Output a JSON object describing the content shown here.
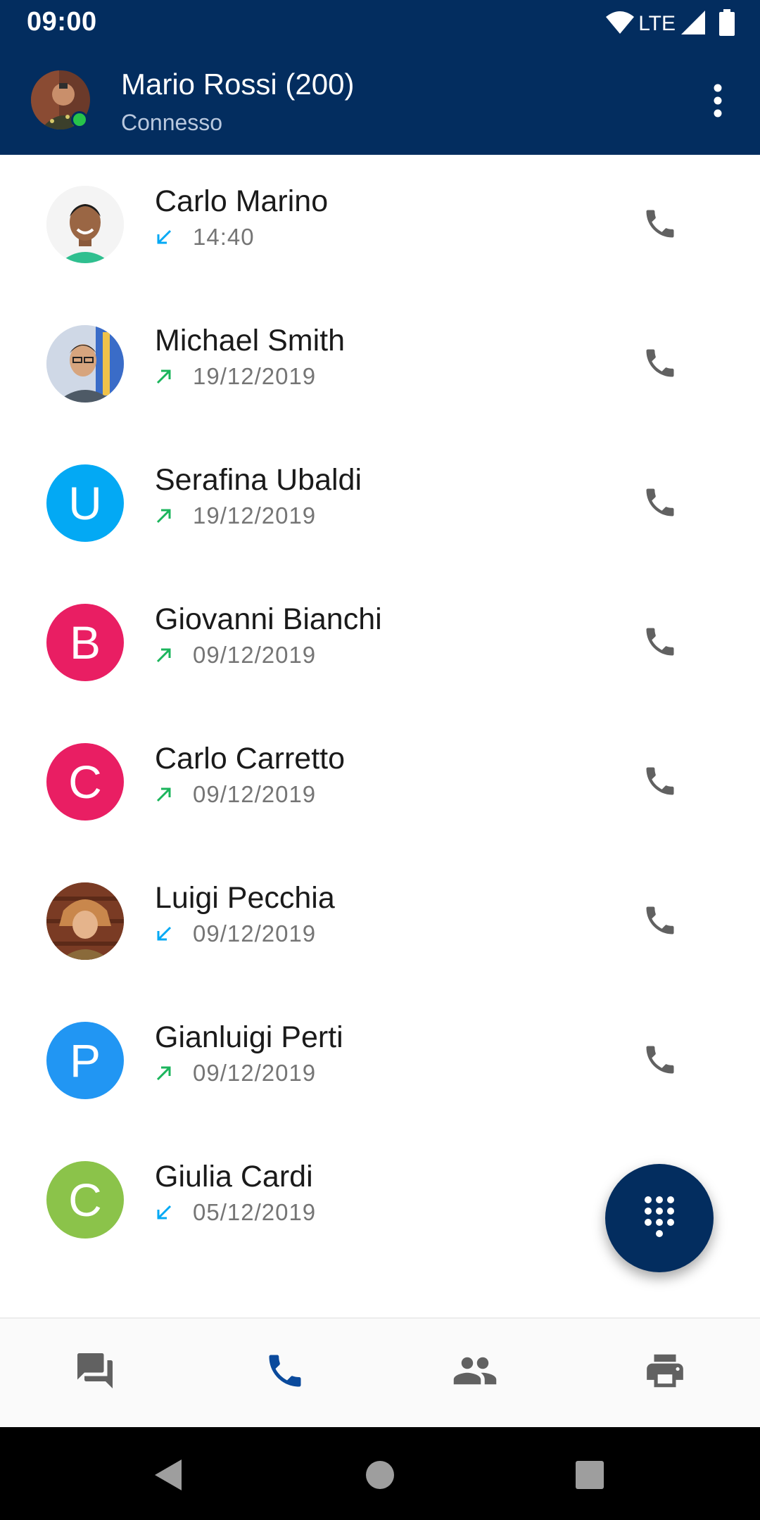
{
  "status_bar": {
    "time": "09:00",
    "network": "LTE"
  },
  "header": {
    "title": "Mario Rossi (200)",
    "subtitle": "Connesso",
    "presence_color": "#27c34a",
    "menu_icon": "more-vert-icon"
  },
  "calls": [
    {
      "name": "Carlo Marino",
      "when": "14:40",
      "direction": "incoming",
      "avatar": {
        "type": "photo",
        "initial": ""
      }
    },
    {
      "name": "Michael Smith",
      "when": "19/12/2019",
      "direction": "outgoing",
      "avatar": {
        "type": "photo",
        "initial": ""
      }
    },
    {
      "name": "Serafina Ubaldi",
      "when": "19/12/2019",
      "direction": "outgoing",
      "avatar": {
        "type": "initial",
        "initial": "U",
        "color": "#03a9f4"
      }
    },
    {
      "name": "Giovanni Bianchi",
      "when": "09/12/2019",
      "direction": "outgoing",
      "avatar": {
        "type": "initial",
        "initial": "B",
        "color": "#e91e63"
      }
    },
    {
      "name": "Carlo Carretto",
      "when": "09/12/2019",
      "direction": "outgoing",
      "avatar": {
        "type": "initial",
        "initial": "C",
        "color": "#e91e63"
      }
    },
    {
      "name": "Luigi Pecchia",
      "when": "09/12/2019",
      "direction": "incoming",
      "avatar": {
        "type": "photo",
        "initial": ""
      }
    },
    {
      "name": "Gianluigi Perti",
      "when": "09/12/2019",
      "direction": "outgoing",
      "avatar": {
        "type": "initial",
        "initial": "P",
        "color": "#2196f3"
      }
    },
    {
      "name": "Giulia Cardi",
      "when": "05/12/2019",
      "direction": "incoming",
      "avatar": {
        "type": "initial",
        "initial": "C",
        "color": "#8bc34a"
      }
    }
  ],
  "colors": {
    "primary": "#032d5f",
    "incoming_arrow": "#03a9f4",
    "outgoing_arrow": "#1bb55c",
    "icon_gray": "#616161",
    "active_tab": "#0a4a9c"
  },
  "fab": {
    "icon": "dialpad-icon"
  },
  "bottom_nav": [
    {
      "icon": "chat-icon",
      "active": false
    },
    {
      "icon": "phone-icon",
      "active": true
    },
    {
      "icon": "people-icon",
      "active": false
    },
    {
      "icon": "fax-icon",
      "active": false
    }
  ],
  "system_nav": [
    "back-icon",
    "home-icon",
    "recents-icon"
  ]
}
